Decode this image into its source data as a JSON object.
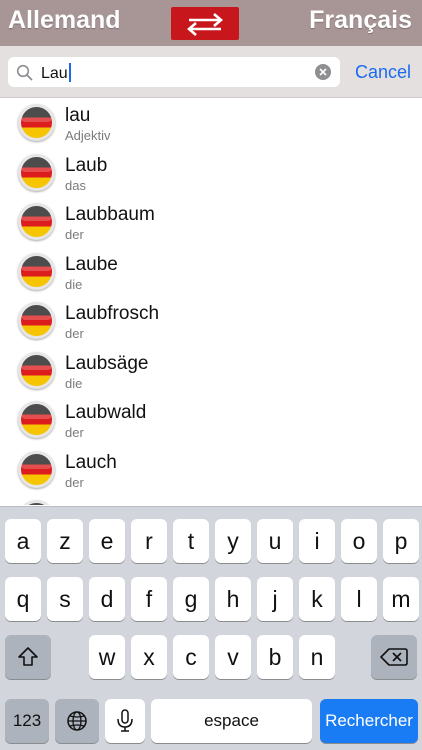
{
  "header": {
    "source_language": "Allemand",
    "target_language": "Français",
    "swap_icon": "swap-arrows-icon",
    "accent_color": "#c8161d",
    "bar_color": "#a89596"
  },
  "search": {
    "query": "Lau",
    "cancel_label": "Cancel",
    "search_icon": "magnifier-icon",
    "clear_icon": "clear-x-icon"
  },
  "results": [
    {
      "word": "lau",
      "grammar": "Adjektiv",
      "flag": "german-flag-icon"
    },
    {
      "word": "Laub",
      "grammar": "das",
      "flag": "german-flag-icon"
    },
    {
      "word": "Laubbaum",
      "grammar": "der",
      "flag": "german-flag-icon"
    },
    {
      "word": "Laube",
      "grammar": "die",
      "flag": "german-flag-icon"
    },
    {
      "word": "Laubfrosch",
      "grammar": "der",
      "flag": "german-flag-icon"
    },
    {
      "word": "Laubsäge",
      "grammar": "die",
      "flag": "german-flag-icon"
    },
    {
      "word": "Laubwald",
      "grammar": "der",
      "flag": "german-flag-icon"
    },
    {
      "word": "Lauch",
      "grammar": "der",
      "flag": "german-flag-icon"
    }
  ],
  "keyboard": {
    "row1": [
      "a",
      "z",
      "e",
      "r",
      "t",
      "y",
      "u",
      "i",
      "o",
      "p"
    ],
    "row2": [
      "q",
      "s",
      "d",
      "f",
      "g",
      "h",
      "j",
      "k",
      "l",
      "m"
    ],
    "row3": [
      "w",
      "x",
      "c",
      "v",
      "b",
      "n"
    ],
    "numbers_label": "123",
    "space_label": "espace",
    "search_label": "Rechercher",
    "shift_icon": "shift-icon",
    "backspace_icon": "backspace-icon",
    "globe_icon": "globe-icon",
    "mic_icon": "microphone-icon"
  }
}
